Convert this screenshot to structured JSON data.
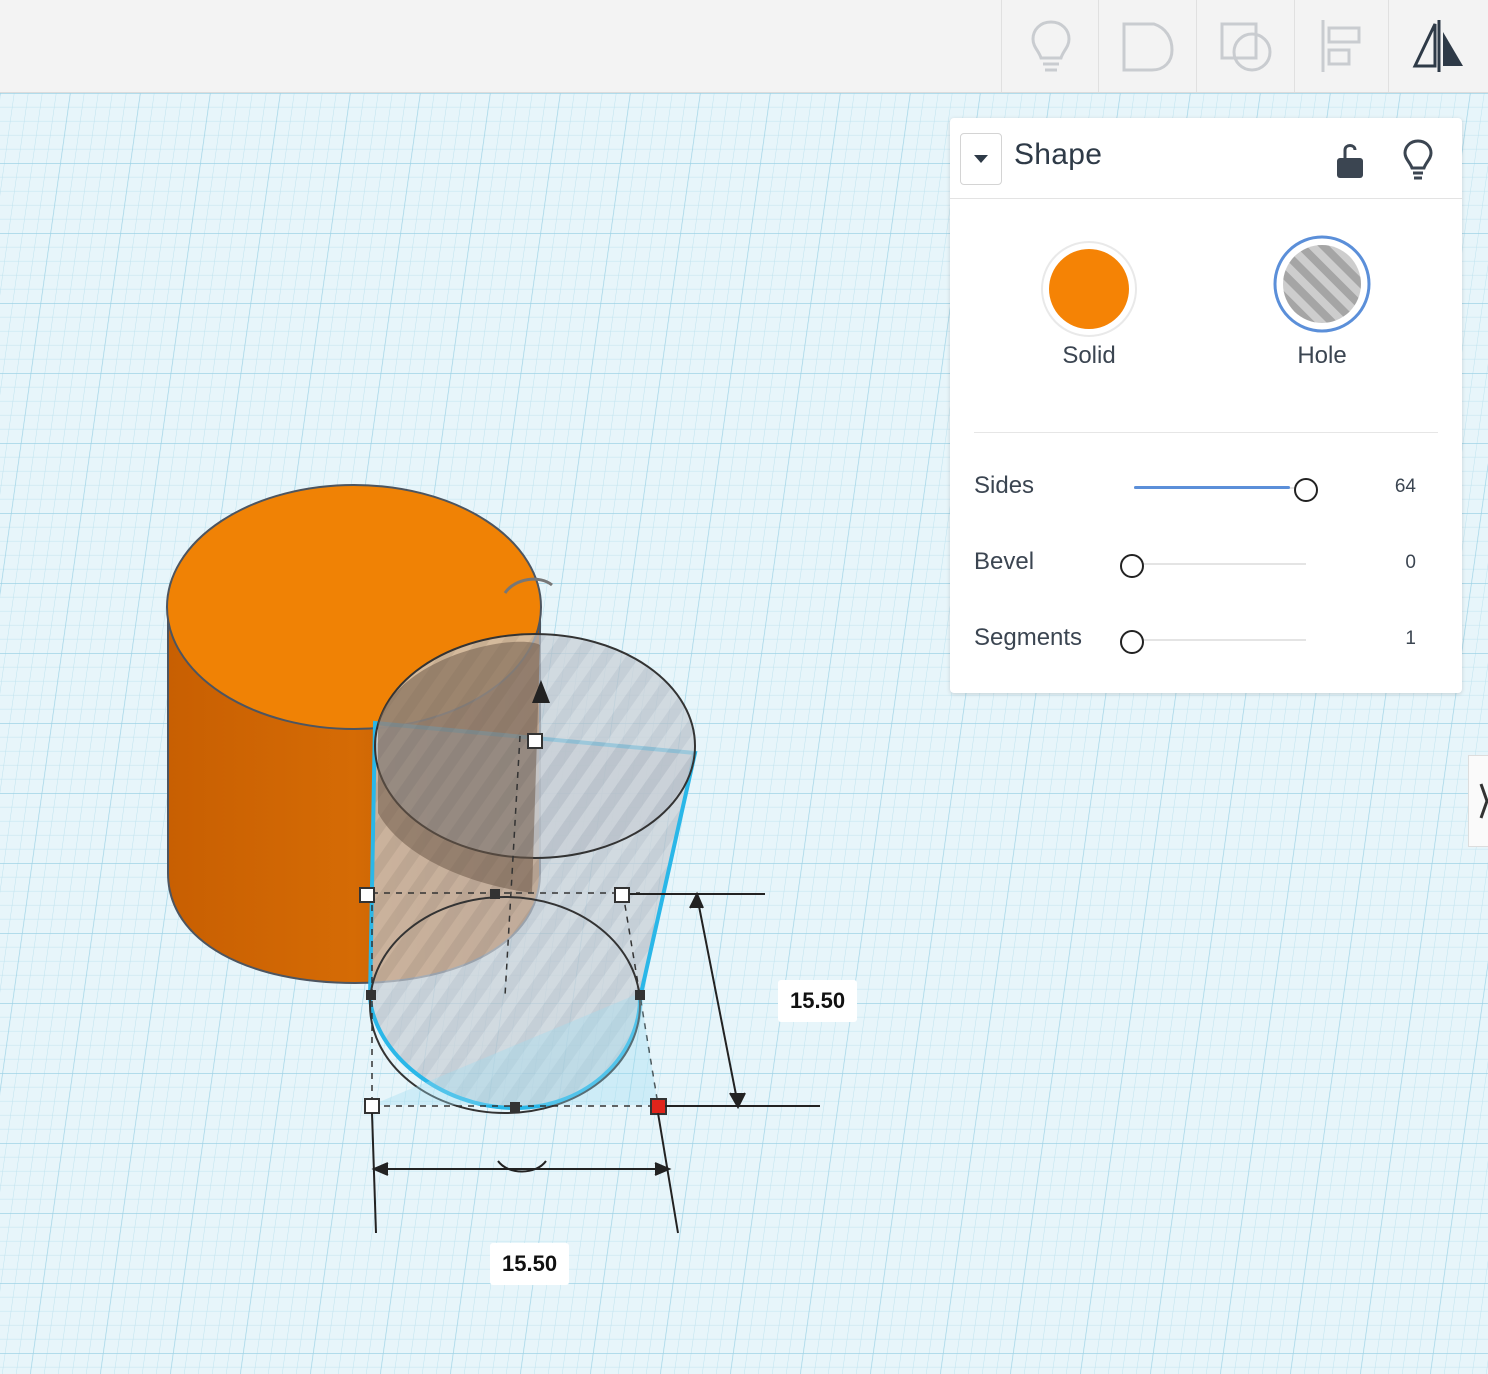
{
  "toolbar": {
    "buttons": [
      {
        "name": "lightbulb-icon"
      },
      {
        "name": "group-icon"
      },
      {
        "name": "ungroup-icon"
      },
      {
        "name": "align-icon"
      },
      {
        "name": "mirror-icon"
      }
    ]
  },
  "panel": {
    "title": "Shape",
    "solid_label": "Solid",
    "hole_label": "Hole",
    "solid_color": "#f58305",
    "selected_mode": "Hole",
    "properties": [
      {
        "label": "Sides",
        "value": "64",
        "fraction": 1.0
      },
      {
        "label": "Bevel",
        "value": "0",
        "fraction": 0.0
      },
      {
        "label": "Segments",
        "value": "1",
        "fraction": 0.0
      }
    ]
  },
  "scene": {
    "height_dimension": "15.50",
    "width_dimension": "15.50",
    "accent_color": "#2ab7e8"
  }
}
